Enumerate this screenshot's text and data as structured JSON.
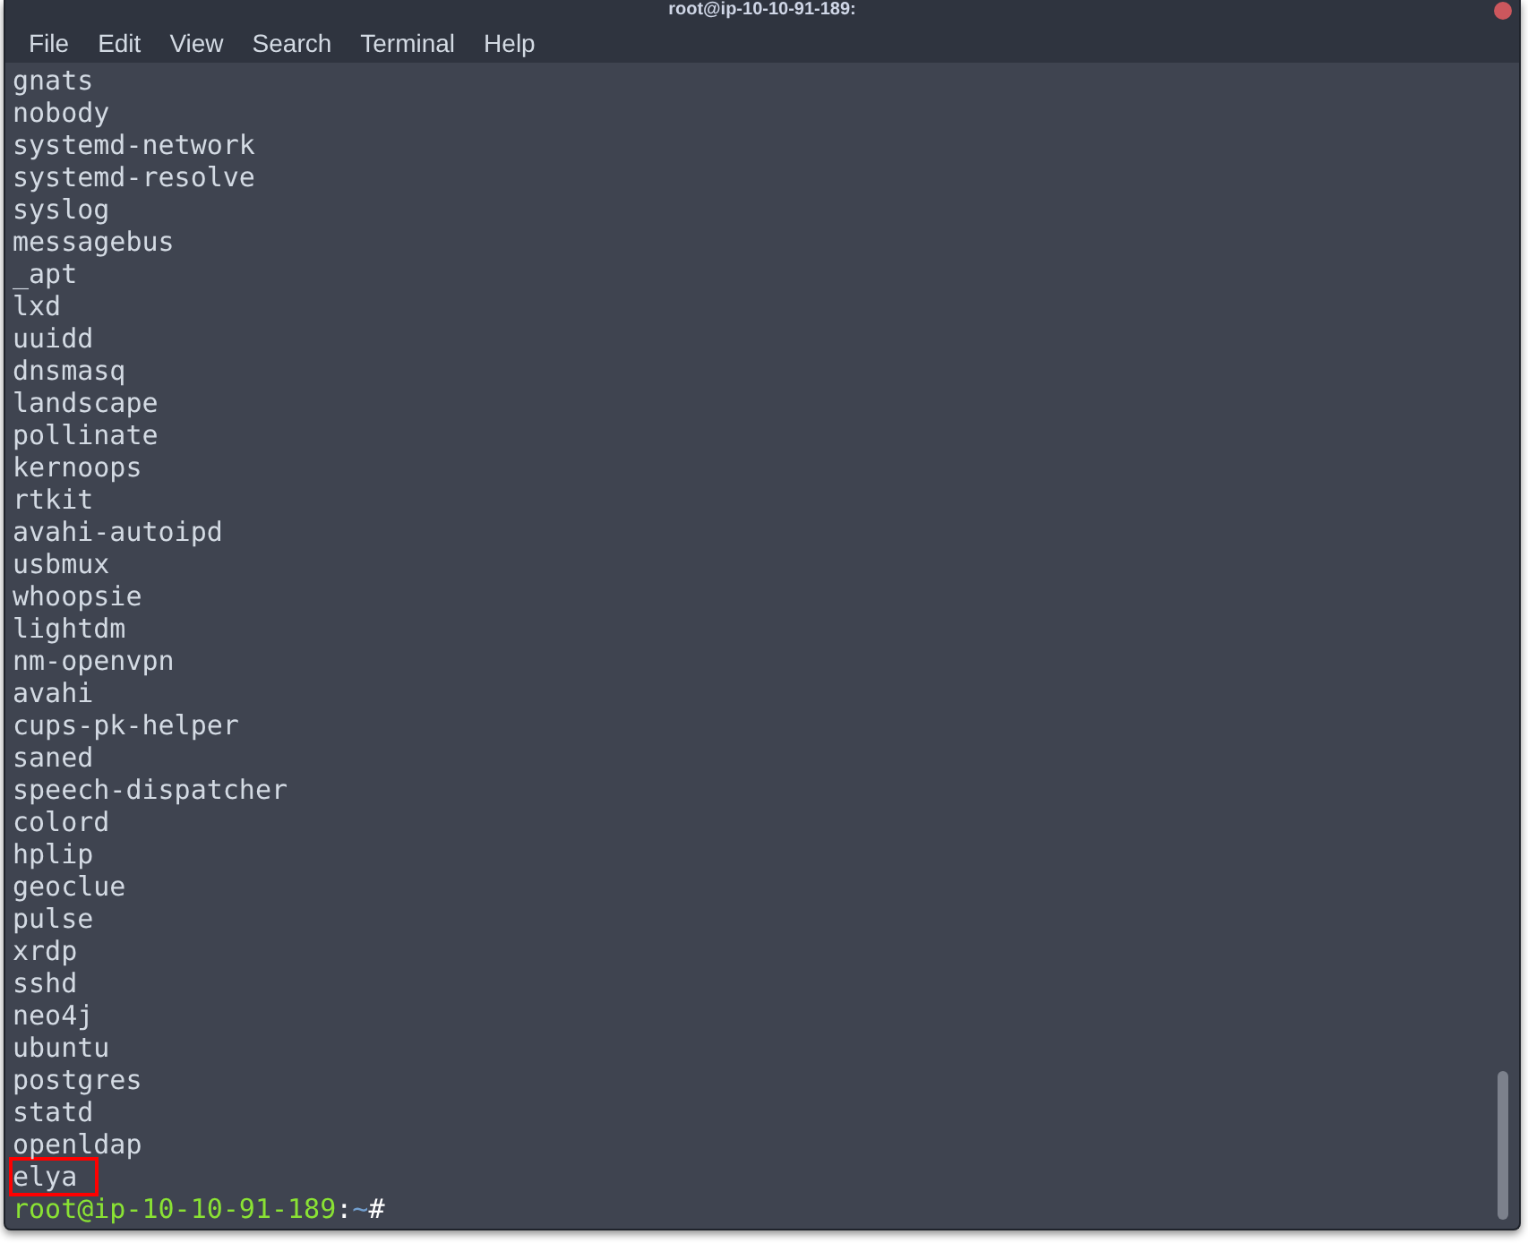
{
  "window": {
    "title": "root@ip-10-10-91-189:"
  },
  "menu": [
    {
      "label": "File"
    },
    {
      "label": "Edit"
    },
    {
      "label": "View"
    },
    {
      "label": "Search"
    },
    {
      "label": "Terminal"
    },
    {
      "label": "Help"
    }
  ],
  "output_lines": [
    {
      "text": "gnats",
      "highlighted": false
    },
    {
      "text": "nobody",
      "highlighted": false
    },
    {
      "text": "systemd-network",
      "highlighted": false
    },
    {
      "text": "systemd-resolve",
      "highlighted": false
    },
    {
      "text": "syslog",
      "highlighted": false
    },
    {
      "text": "messagebus",
      "highlighted": false
    },
    {
      "text": "_apt",
      "highlighted": false
    },
    {
      "text": "lxd",
      "highlighted": false
    },
    {
      "text": "uuidd",
      "highlighted": false
    },
    {
      "text": "dnsmasq",
      "highlighted": false
    },
    {
      "text": "landscape",
      "highlighted": false
    },
    {
      "text": "pollinate",
      "highlighted": false
    },
    {
      "text": "kernoops",
      "highlighted": false
    },
    {
      "text": "rtkit",
      "highlighted": false
    },
    {
      "text": "avahi-autoipd",
      "highlighted": false
    },
    {
      "text": "usbmux",
      "highlighted": false
    },
    {
      "text": "whoopsie",
      "highlighted": false
    },
    {
      "text": "lightdm",
      "highlighted": false
    },
    {
      "text": "nm-openvpn",
      "highlighted": false
    },
    {
      "text": "avahi",
      "highlighted": false
    },
    {
      "text": "cups-pk-helper",
      "highlighted": false
    },
    {
      "text": "saned",
      "highlighted": false
    },
    {
      "text": "speech-dispatcher",
      "highlighted": false
    },
    {
      "text": "colord",
      "highlighted": false
    },
    {
      "text": "hplip",
      "highlighted": false
    },
    {
      "text": "geoclue",
      "highlighted": false
    },
    {
      "text": "pulse",
      "highlighted": false
    },
    {
      "text": "xrdp",
      "highlighted": false
    },
    {
      "text": "sshd",
      "highlighted": false
    },
    {
      "text": "neo4j",
      "highlighted": false
    },
    {
      "text": "ubuntu",
      "highlighted": false
    },
    {
      "text": "postgres",
      "highlighted": false
    },
    {
      "text": "statd",
      "highlighted": false
    },
    {
      "text": "openldap",
      "highlighted": false
    },
    {
      "text": "elya",
      "highlighted": true
    }
  ],
  "prompt": {
    "user_host": "root@ip-10-10-91-189",
    "separator": ":",
    "path": "~",
    "symbol": "#"
  }
}
